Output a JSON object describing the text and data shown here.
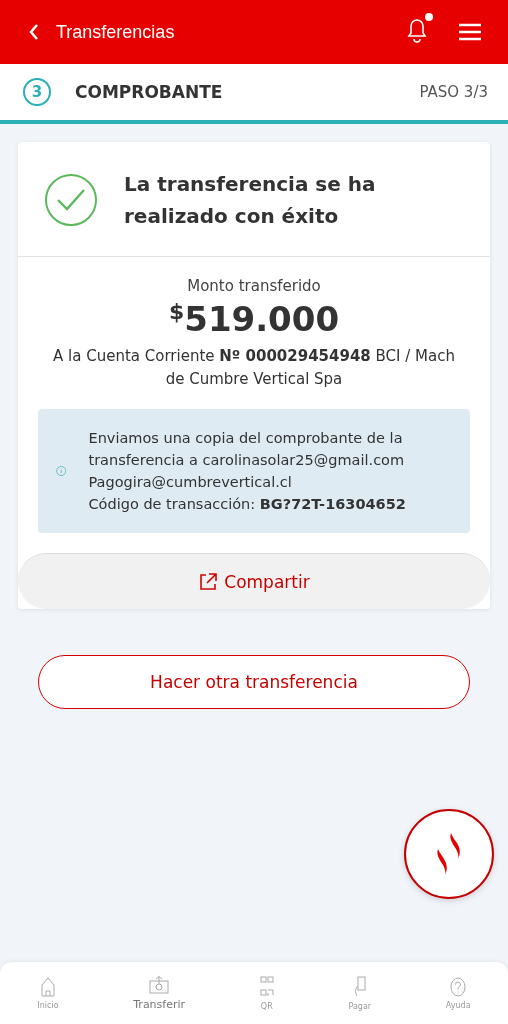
{
  "header": {
    "title": "Transferencias",
    "has_notification": true
  },
  "step": {
    "number": "3",
    "title": "COMPROBANTE",
    "progress": "PASO 3/3"
  },
  "success": {
    "message": "La transferencia se ha realizado con éxito"
  },
  "amount": {
    "label": "Monto transferido",
    "currency": "$",
    "value": "519.000"
  },
  "destination": "A la Cuenta Corriente **Nº 000029454948** BCI / Mach de Cumbre Vertical Spa",
  "info": "Enviamos una copia del comprobante de la transferencia a carolinasolar25@gmail.com Pagogira@cumbrevertical.cl\nCódigo de transacción: **BG?72T-16304652**",
  "share_button": "Compartir",
  "another_button": "Hacer otra transferencia",
  "bottom_nav": [
    {
      "label": "Inicio",
      "kind": "home",
      "selected": false
    },
    {
      "label": "Transferir",
      "kind": "transfer",
      "selected": true
    },
    {
      "label": "QR",
      "kind": "qr",
      "selected": false
    },
    {
      "label": "Pagar",
      "kind": "pay",
      "selected": false
    },
    {
      "label": "Ayuda",
      "kind": "help",
      "selected": false
    }
  ]
}
